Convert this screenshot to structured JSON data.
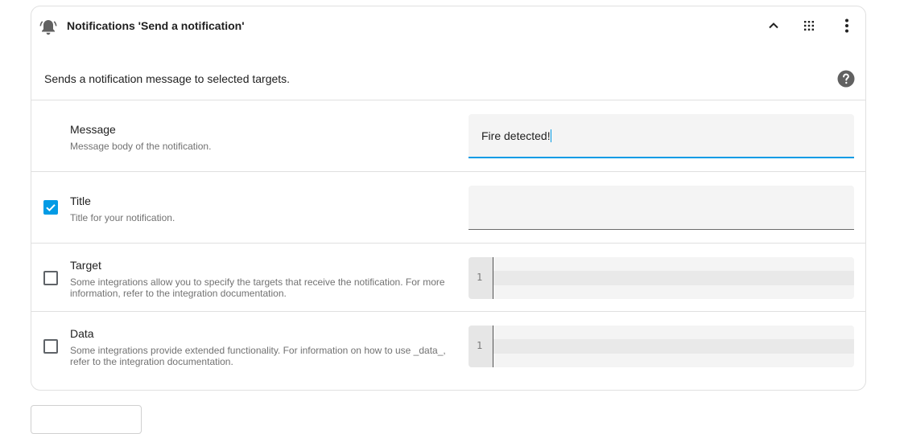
{
  "header": {
    "title": "Notifications 'Send a notification'",
    "icons": {
      "bell": "bell-ring-icon",
      "collapse": "chevron-up-icon",
      "drag": "drag-handle-icon",
      "menu": "more-vertical-icon"
    }
  },
  "description": "Sends a notification message to selected targets.",
  "help_icon": "help-circle-icon",
  "fields": [
    {
      "label": "Message",
      "description": "Message body of the notification.",
      "value": "Fire detected!",
      "checkbox": null
    },
    {
      "label": "Title",
      "description": "Title for your notification.",
      "value": "",
      "checkbox": "checked"
    },
    {
      "label": "Target",
      "description": "Some integrations allow you to specify the targets that receive the notification. For more information, refer to the integration documentation.",
      "line_number": "1",
      "checkbox": "unchecked"
    },
    {
      "label": "Data",
      "description": "Some integrations provide extended functionality. For information on how to use _data_, refer to the integration documentation.",
      "line_number": "1",
      "checkbox": "unchecked"
    }
  ],
  "colors": {
    "accent": "#039be5",
    "icon": "#616161",
    "border": "#e0e0e0",
    "field_bg": "#f4f4f4"
  }
}
